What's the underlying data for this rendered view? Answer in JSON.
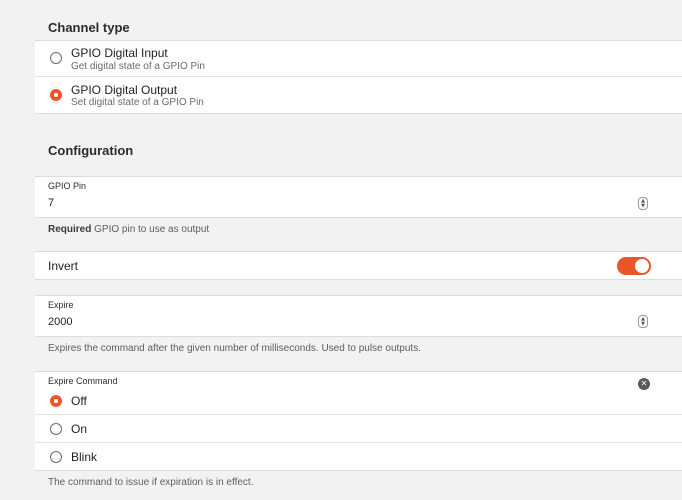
{
  "channel_type": {
    "title": "Channel type",
    "options": [
      {
        "label": "GPIO Digital Input",
        "description": "Get digital state of a GPIO Pin",
        "selected": false
      },
      {
        "label": "GPIO Digital Output",
        "description": "Set digital state of a GPIO Pin",
        "selected": true
      }
    ]
  },
  "configuration": {
    "title": "Configuration",
    "gpio_pin": {
      "label": "GPIO Pin",
      "value": "7",
      "help_required": "Required",
      "help_text": " GPIO pin to use as output"
    },
    "invert": {
      "label": "Invert",
      "enabled": true
    },
    "expire": {
      "label": "Expire",
      "value": "2000",
      "help_text": "Expires the command after the given number of milliseconds. Used to pulse outputs."
    },
    "expire_command": {
      "label": "Expire Command",
      "options": [
        {
          "label": "Off",
          "selected": true
        },
        {
          "label": "On",
          "selected": false
        },
        {
          "label": "Blink",
          "selected": false
        }
      ],
      "help_text": "The command to issue if expiration is in effect."
    }
  },
  "colors": {
    "accent": "#e8562a"
  },
  "icons": {
    "stepper": "up-down-chevron-icon",
    "clear": "close-circle-icon"
  }
}
